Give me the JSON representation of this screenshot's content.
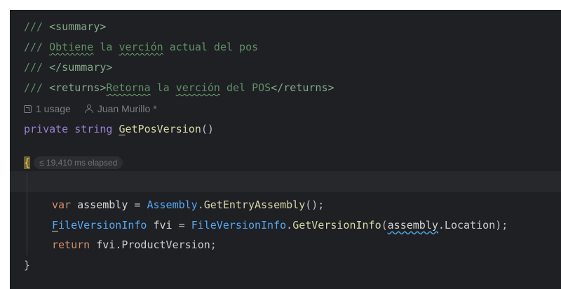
{
  "code": {
    "line1": {
      "slashes": "///",
      "open_tag": "<summary>"
    },
    "line2": {
      "slashes": "///",
      "word1": "Obtiene",
      "mid": " la ",
      "word2": "verción",
      "rest": " actual del pos"
    },
    "line3": {
      "slashes": "///",
      "close_tag": "</summary>"
    },
    "line4": {
      "slashes": "///",
      "open_tag": "<returns>",
      "word1": "Retorna",
      "mid": " la ",
      "word2": "verción",
      "rest": " del POS",
      "close_tag": "</returns>"
    },
    "inlay": {
      "usage": "1 usage",
      "author": "Juan Murillo *"
    },
    "line6": {
      "kw1": "private",
      "kw2": "string",
      "first_char": "G",
      "method": "etPosVersion",
      "parens": "()"
    },
    "line7": {
      "brace": "{",
      "elapsed": "≤ 19,410 ms elapsed"
    },
    "line9": {
      "kw": "var",
      "name": "assembly",
      "eq": " = ",
      "type": "Assembly",
      "dot": ".",
      "method": "GetEntryAssembly",
      "end": "();"
    },
    "line10": {
      "type_first": "F",
      "type_rest": "ileVersionInfo",
      "name": "fvi",
      "eq": " = ",
      "type": "FileVersionInfo",
      "dot": ".",
      "method": "GetVersionInfo",
      "open": "(",
      "arg": "assembly",
      "prop": ".Location",
      "end": ");"
    },
    "line11": {
      "kw": "return",
      "obj": "fvi",
      "prop": ".ProductVersion",
      "end": ";"
    },
    "line12": {
      "brace": "}"
    }
  }
}
